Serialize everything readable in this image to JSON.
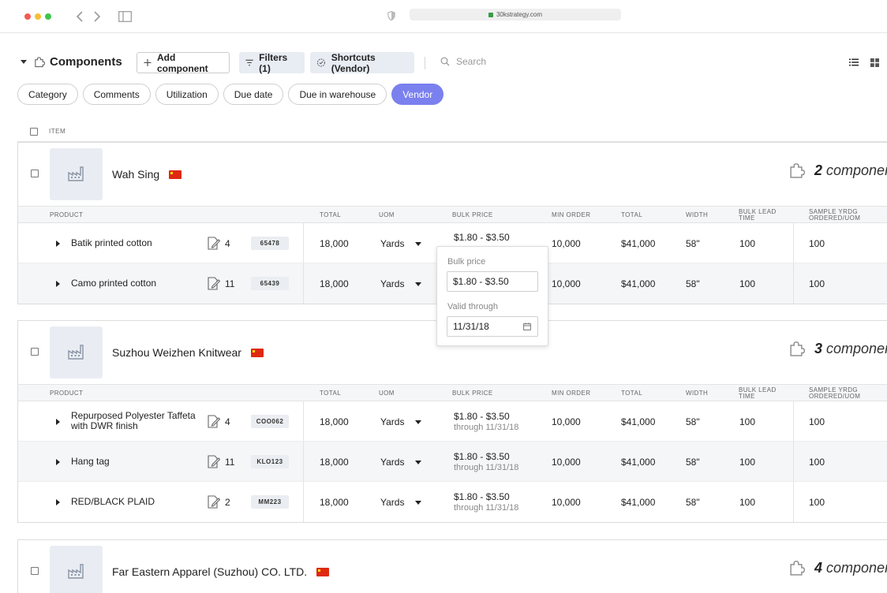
{
  "browser": {
    "url": "30kstrategy.com"
  },
  "toolbar": {
    "title": "Components",
    "add_label": "Add component",
    "filters_label": "Filters (1)",
    "shortcuts_label": "Shortcuts (Vendor)",
    "search_placeholder": "Search"
  },
  "chips": [
    "Category",
    "Comments",
    "Utilization",
    "Due date",
    "Due in warehouse",
    "Vendor"
  ],
  "list": {
    "item_header": "ITEM"
  },
  "columns": {
    "product": "PRODUCT",
    "total": "TOTAL",
    "uom": "UOM",
    "bulk_price": "BULK PRICE",
    "min_order": "MIN ORDER",
    "total2": "TOTAL",
    "width": "WIDTH",
    "bulk_lead_1": "BULK LEAD",
    "bulk_lead_2": "TIME",
    "sample_1": "SAMPLE YRDG",
    "sample_2": "ORDERED/UOM"
  },
  "component_unit": "component",
  "vendors": [
    {
      "name": "Wah Sing",
      "count": "2",
      "rows": [
        {
          "product": "Batik printed cotton",
          "docs": "4",
          "code": "65478",
          "total": "18,000",
          "uom": "Yards",
          "price": "$1.80 - $3.50",
          "through": "",
          "min_order": "10,000",
          "total2": "$41,000",
          "width": "58\"",
          "lead": "100",
          "sample": "100"
        },
        {
          "product": "Camo printed cotton",
          "docs": "11",
          "code": "65439",
          "total": "18,000",
          "uom": "Yards",
          "price": "",
          "through": "",
          "min_order": "10,000",
          "total2": "$41,000",
          "width": "58\"",
          "lead": "100",
          "sample": "100"
        }
      ]
    },
    {
      "name": "Suzhou Weizhen Knitwear",
      "count": "3",
      "rows": [
        {
          "product": "Repurposed Polyester Taffeta with DWR finish",
          "docs": "4",
          "code": "COO062",
          "total": "18,000",
          "uom": "Yards",
          "price": "$1.80 - $3.50",
          "through": "through 11/31/18",
          "min_order": "10,000",
          "total2": "$41,000",
          "width": "58\"",
          "lead": "100",
          "sample": "100"
        },
        {
          "product": "Hang tag",
          "docs": "11",
          "code": "KLO123",
          "total": "18,000",
          "uom": "Yards",
          "price": "$1.80 - $3.50",
          "through": "through 11/31/18",
          "min_order": "10,000",
          "total2": "$41,000",
          "width": "58\"",
          "lead": "100",
          "sample": "100"
        },
        {
          "product": "RED/BLACK PLAID",
          "docs": "2",
          "code": "MM223",
          "total": "18,000",
          "uom": "Yards",
          "price": "$1.80 - $3.50",
          "through": "through 11/31/18",
          "min_order": "10,000",
          "total2": "$41,000",
          "width": "58\"",
          "lead": "100",
          "sample": "100"
        }
      ]
    },
    {
      "name": "Far Eastern Apparel (Suzhou) CO. LTD.",
      "count": "4",
      "rows": []
    }
  ],
  "popover": {
    "bulk_label": "Bulk price",
    "bulk_value": "$1.80 - $3.50",
    "valid_label": "Valid through",
    "valid_value": "11/31/18"
  },
  "colors": {
    "accent": "#7a80ee",
    "flag_red": "#de2910",
    "button_bg": "#e8ecf3"
  }
}
